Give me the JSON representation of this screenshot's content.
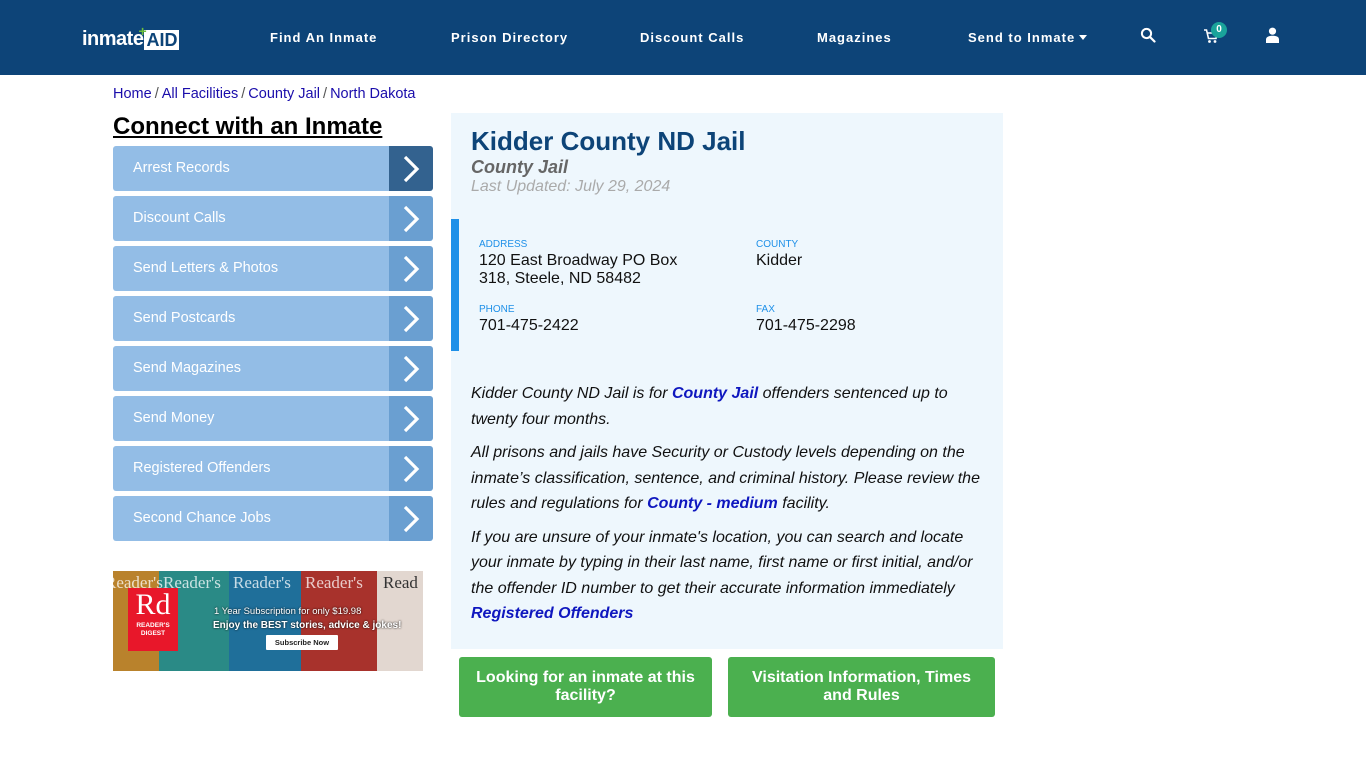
{
  "brand": {
    "logo_left": "inmate",
    "logo_right": "AID",
    "logo_plus": "+"
  },
  "nav": {
    "items": [
      "Find An Inmate",
      "Prison Directory",
      "Discount Calls",
      "Magazines",
      "Send to Inmate"
    ],
    "cart_count": "0",
    "icons": [
      "search-icon",
      "cart-icon",
      "user-icon"
    ]
  },
  "breadcrumb": {
    "items": [
      "Home",
      "All Facilities",
      "County Jail",
      "North Dakota"
    ],
    "separator": "/"
  },
  "sidebar": {
    "title": "Connect with an Inmate",
    "items": [
      {
        "label": "Arrest Records"
      },
      {
        "label": "Discount Calls"
      },
      {
        "label": "Send Letters & Photos"
      },
      {
        "label": "Send Postcards"
      },
      {
        "label": "Send Magazines"
      },
      {
        "label": "Send Money"
      },
      {
        "label": "Registered Offenders"
      },
      {
        "label": "Second Chance Jobs"
      }
    ]
  },
  "ad": {
    "mastheads": [
      "Reader's",
      "Reader's",
      "Reader's",
      "Reader's",
      "Read"
    ],
    "logo_big": "Rd",
    "logo_small1": "READER'S",
    "logo_small2": "DIGEST",
    "offer_line1": "1 Year Subscription for only $19.98",
    "offer_line2": "Enjoy the BEST stories, advice & jokes!",
    "cta": "Subscribe Now"
  },
  "facility": {
    "name": "Kidder County ND Jail",
    "type": "County Jail",
    "last_updated": "Last Updated: July 29, 2024",
    "address_label": "ADDRESS",
    "address_line1": "120 East Broadway PO Box",
    "address_line2": "318, Steele, ND 58482",
    "county_label": "COUNTY",
    "county": "Kidder",
    "phone_label": "PHONE",
    "phone": "701-475-2422",
    "fax_label": "FAX",
    "fax": "701-475-2298"
  },
  "description": {
    "p1_before": "Kidder County ND Jail is for ",
    "p1_link": "County Jail",
    "p1_after": " offenders sentenced up to twenty four months.",
    "p2_before": "All prisons and jails have Security or Custody levels depending on the inmate’s classification, sentence, and criminal history. Please review the rules and regulations for ",
    "p2_link": "County - medium",
    "p2_after": " facility.",
    "p3": "If you are unsure of your inmate's location, you can search and locate your inmate by typing in their last name, first name or first initial, and/or the offender ID number to get their accurate information immediately",
    "p3_link": "Registered Offenders"
  },
  "buttons": {
    "looking": "Looking for an inmate at this facility?",
    "visitation": "Visitation Information, Times and Rules"
  },
  "colors": {
    "nav_bg": "#0d4478",
    "sidebar_item": "#93bde6",
    "sidebar_arrow": "#6a9fd1",
    "accent_blue": "#1e90e8",
    "button_green": "#4bb04f",
    "link": "#0f17bf"
  }
}
